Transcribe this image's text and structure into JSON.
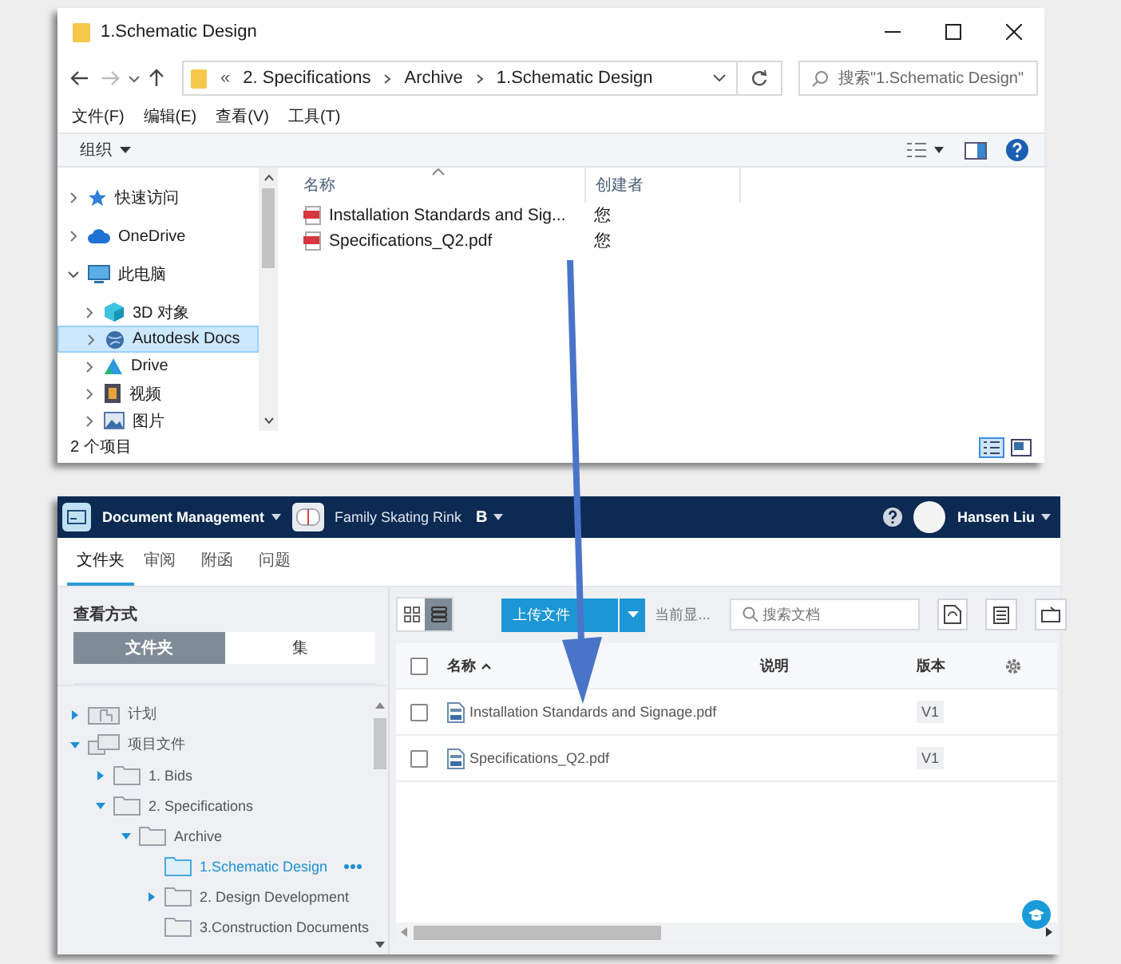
{
  "explorer": {
    "title": "1.Schematic Design",
    "breadcrumb": [
      "2. Specifications",
      "Archive",
      "1.Schematic Design"
    ],
    "overflow_mark": "«",
    "search_placeholder": "搜索\"1.Schematic Design\"",
    "menu": [
      "文件(F)",
      "编辑(E)",
      "查看(V)",
      "工具(T)"
    ],
    "organize": "组织",
    "tree": [
      {
        "label": "快速访问",
        "kind": "star",
        "expanded": false,
        "selected": false
      },
      {
        "label": "OneDrive",
        "kind": "cloud",
        "expanded": false,
        "selected": false
      },
      {
        "label": "此电脑",
        "kind": "pc",
        "expanded": true,
        "selected": false,
        "children": [
          {
            "label": "3D 对象",
            "kind": "cube",
            "expanded": false,
            "selected": false
          },
          {
            "label": "Autodesk Docs",
            "kind": "globe",
            "expanded": false,
            "selected": true
          },
          {
            "label": "Drive",
            "kind": "drive",
            "expanded": false,
            "selected": false
          },
          {
            "label": "视频",
            "kind": "video",
            "expanded": false,
            "selected": false
          },
          {
            "label": "图片",
            "kind": "image",
            "expanded": false,
            "selected": false
          }
        ]
      }
    ],
    "columns": [
      "名称",
      "创建者"
    ],
    "files": [
      {
        "name": "Installation Standards and Sig...",
        "creator": "您"
      },
      {
        "name": "Specifications_Q2.pdf",
        "creator": "您"
      }
    ],
    "status": "2 个项目"
  },
  "app": {
    "module": "Document Management",
    "project": "Family Skating Rink",
    "project_badge": "B",
    "user": "Hansen Liu",
    "tabs": [
      {
        "label": "文件夹",
        "selected": true
      },
      {
        "label": "审阅",
        "selected": false
      },
      {
        "label": "附函",
        "selected": false
      },
      {
        "label": "问题",
        "selected": false
      }
    ],
    "view_label": "查看方式",
    "view_modes": [
      {
        "label": "文件夹",
        "selected": true
      },
      {
        "label": "集",
        "selected": false
      }
    ],
    "tree": [
      {
        "label": "计划",
        "kind": "plans",
        "expanded": false,
        "selected": false
      },
      {
        "label": "项目文件",
        "kind": "project",
        "expanded": true,
        "selected": false,
        "children": [
          {
            "label": "1. Bids",
            "kind": "folder",
            "expanded": false,
            "selected": false
          },
          {
            "label": "2. Specifications",
            "kind": "folder",
            "expanded": true,
            "selected": false,
            "children": [
              {
                "label": "Archive",
                "kind": "folder",
                "expanded": true,
                "selected": false,
                "children": [
                  {
                    "label": "1.Schematic Design",
                    "kind": "folder",
                    "selected": true
                  },
                  {
                    "label": "2. Design Development",
                    "kind": "folder",
                    "expanded": false,
                    "selected": false
                  },
                  {
                    "label": "3.Construction Documents",
                    "kind": "folder",
                    "selected": false
                  }
                ]
              }
            ]
          }
        ]
      }
    ],
    "layout_modes": [
      {
        "kind": "grid",
        "selected": false
      },
      {
        "kind": "list",
        "selected": true
      }
    ],
    "upload": "上传文件",
    "showing": "当前显...",
    "search_placeholder": "搜索文档",
    "columns": [
      "名称",
      "说明",
      "版本"
    ],
    "select_all_checked": false,
    "files": [
      {
        "name": "Installation Standards and Signage.pdf",
        "version": "V1",
        "checked": false
      },
      {
        "name": "Specifications_Q2.pdf",
        "version": "V1",
        "checked": false
      }
    ]
  }
}
